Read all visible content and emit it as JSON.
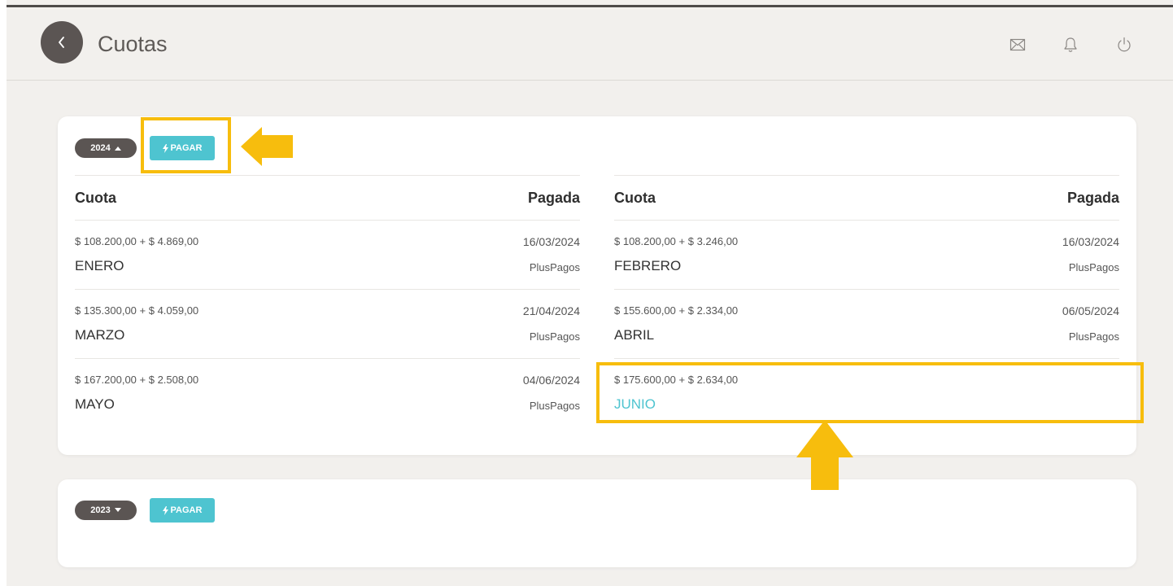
{
  "header": {
    "title": "Cuotas",
    "icons": [
      "back-chevron-icon",
      "mail-icon",
      "bell-icon",
      "power-icon"
    ]
  },
  "colors": {
    "accent": "#4ec4d0",
    "dark": "#5b5553",
    "highlight": "#f7bd0d",
    "background": "#f2f0ed"
  },
  "years": [
    {
      "year_label": "2024",
      "expanded": true,
      "pay_label": "PAGAR",
      "columns": {
        "cuota_header": "Cuota",
        "pagada_header": "Pagada"
      },
      "installments": [
        {
          "amount": "$ 108.200,00 + $ 4.869,00",
          "month": "ENERO",
          "date": "16/03/2024",
          "method": "PlusPagos"
        },
        {
          "amount": "$ 108.200,00 + $ 3.246,00",
          "month": "FEBRERO",
          "date": "16/03/2024",
          "method": "PlusPagos"
        },
        {
          "amount": "$ 135.300,00 + $ 4.059,00",
          "month": "MARZO",
          "date": "21/04/2024",
          "method": "PlusPagos"
        },
        {
          "amount": "$ 155.600,00 + $ 2.334,00",
          "month": "ABRIL",
          "date": "06/05/2024",
          "method": "PlusPagos"
        },
        {
          "amount": "$ 167.200,00 + $ 2.508,00",
          "month": "MAYO",
          "date": "04/06/2024",
          "method": "PlusPagos"
        },
        {
          "amount": "$ 175.600,00 + $ 2.634,00",
          "month": "JUNIO",
          "date": "",
          "method": ""
        }
      ]
    },
    {
      "year_label": "2023",
      "expanded": false,
      "pay_label": "PAGAR"
    }
  ]
}
